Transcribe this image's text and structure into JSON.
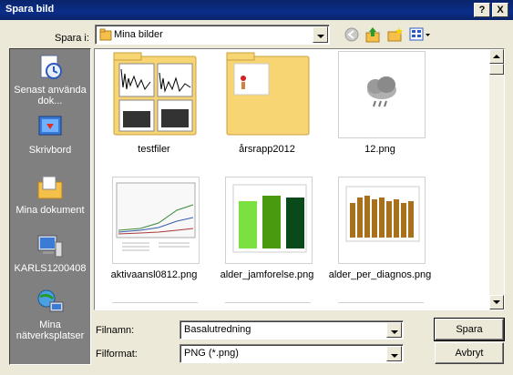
{
  "window": {
    "title": "Spara bild",
    "help_label": "?",
    "close_label": "X"
  },
  "lookin": {
    "label": "Spara i:",
    "value": "Mina bilder"
  },
  "places": [
    {
      "label": "Senast använda dok...",
      "icon": "recent-documents-icon"
    },
    {
      "label": "Skrivbord",
      "icon": "desktop-icon"
    },
    {
      "label": "Mina dokument",
      "icon": "my-documents-icon"
    },
    {
      "label": "KARLS1200408",
      "icon": "my-computer-icon"
    },
    {
      "label": "Mina nätverksplatser",
      "icon": "network-places-icon"
    }
  ],
  "files": [
    {
      "name": "testfiler",
      "kind": "folder"
    },
    {
      "name": "årsrapp2012",
      "kind": "folder"
    },
    {
      "name": "12.png",
      "kind": "image"
    },
    {
      "name": "aktivaansl0812.png",
      "kind": "image"
    },
    {
      "name": "alder_jamforelse.png",
      "kind": "image"
    },
    {
      "name": "alder_per_diagnos.png",
      "kind": "image"
    }
  ],
  "form": {
    "filename_label": "Filnamn:",
    "filename_value": "Basalutredning",
    "format_label": "Filformat:",
    "format_value": "PNG (*.png)"
  },
  "buttons": {
    "save": "Spara",
    "cancel": "Avbryt"
  },
  "colors": {
    "titlebar": "#0a246a",
    "sidebar": "#808080",
    "dialog": "#ece9d8"
  }
}
